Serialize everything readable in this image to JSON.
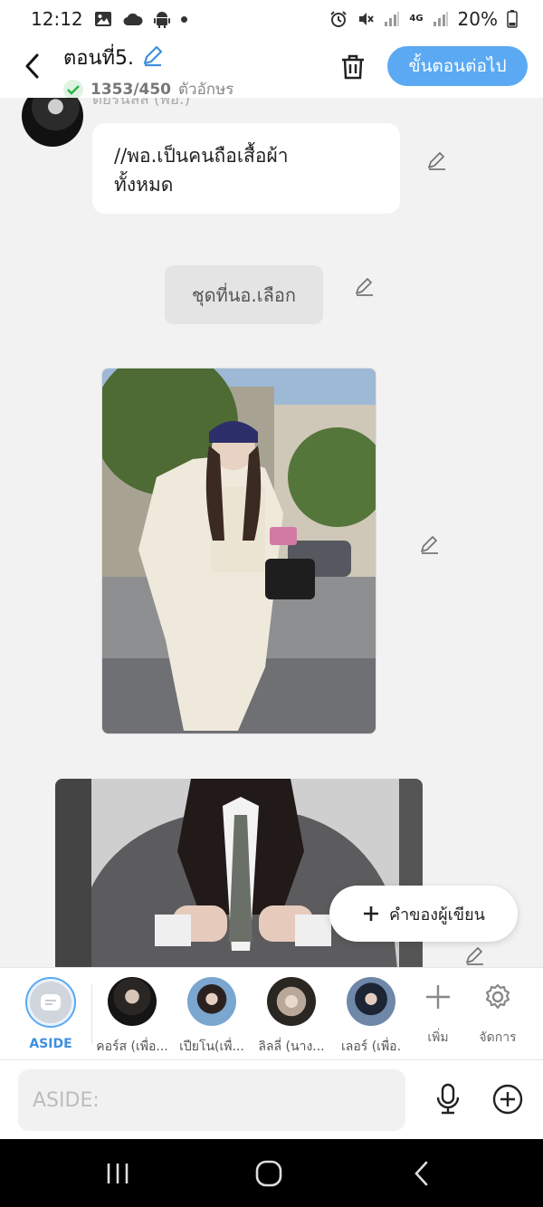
{
  "status_bar": {
    "time": "12:12",
    "network": "4G",
    "battery": "20%"
  },
  "header": {
    "title": "ตอนที่5.",
    "char_count": "1353/450",
    "char_count_unit": "ตัวอักษร",
    "next_button": "ขั้นตอนต่อไป"
  },
  "chat": {
    "sender_name": "ดยิรันลล (พอ.)",
    "messages": [
      {
        "type": "text",
        "text": "//พอ.เป็นคนถือเสื้อผ้า\nทั้งหมด"
      },
      {
        "type": "narration",
        "text": "ชุดที่นอ.เลือก"
      }
    ],
    "author_button": "คำของผู้เขียน"
  },
  "characters": {
    "aside_label": "ASIDE",
    "items": [
      {
        "label": "คอร์ส (เพื่อ..."
      },
      {
        "label": "เปียโน(เพื่..."
      },
      {
        "label": "ลิลลี่ (นาง..."
      },
      {
        "label": "เลอร์ (เพื่อ."
      }
    ],
    "add_label": "เพิ่ม",
    "manage_label": "จัดการ"
  },
  "input": {
    "placeholder": "ASIDE:"
  },
  "colors": {
    "accent": "#5aa9f2",
    "aside_text": "#3e8fe0",
    "background": "#f2f2f2"
  }
}
